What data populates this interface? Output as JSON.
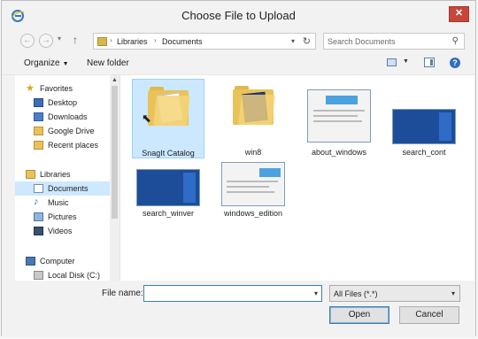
{
  "window": {
    "title": "Choose File to Upload",
    "close_glyph": "✕"
  },
  "nav": {
    "back_glyph": "←",
    "forward_glyph": "→",
    "up_glyph": "↑",
    "breadcrumb": [
      "Libraries",
      "Documents"
    ],
    "search_placeholder": "Search Documents"
  },
  "toolbar": {
    "organize_label": "Organize",
    "new_folder_label": "New folder",
    "help_glyph": "?"
  },
  "sidebar": {
    "favorites": {
      "label": "Favorites",
      "items": [
        "Desktop",
        "Downloads",
        "Google Drive",
        "Recent places"
      ]
    },
    "libraries": {
      "label": "Libraries",
      "items": [
        "Documents",
        "Music",
        "Pictures",
        "Videos"
      ]
    },
    "computer": {
      "label": "Computer",
      "items": [
        "Local Disk (C:)"
      ]
    }
  },
  "files": [
    {
      "name": "SnagIt Catalog",
      "kind": "folder",
      "selected": true
    },
    {
      "name": "win8",
      "kind": "folder",
      "selected": false
    },
    {
      "name": "about_windows",
      "kind": "screenshot-light",
      "selected": false
    },
    {
      "name": "search_cont",
      "kind": "screenshot-dark",
      "selected": false
    },
    {
      "name": "search_winver",
      "kind": "screenshot-dark",
      "selected": false
    },
    {
      "name": "windows_edition",
      "kind": "screenshot-light",
      "selected": false
    }
  ],
  "filename": {
    "label": "File name:",
    "value": ""
  },
  "filetype": {
    "selected": "All Files (*.*)"
  },
  "buttons": {
    "open": "Open",
    "cancel": "Cancel"
  },
  "colors": {
    "selection": "#cce8ff",
    "accent": "#3c7fb1",
    "close": "#c7463b",
    "folder": "#e8c35a"
  }
}
